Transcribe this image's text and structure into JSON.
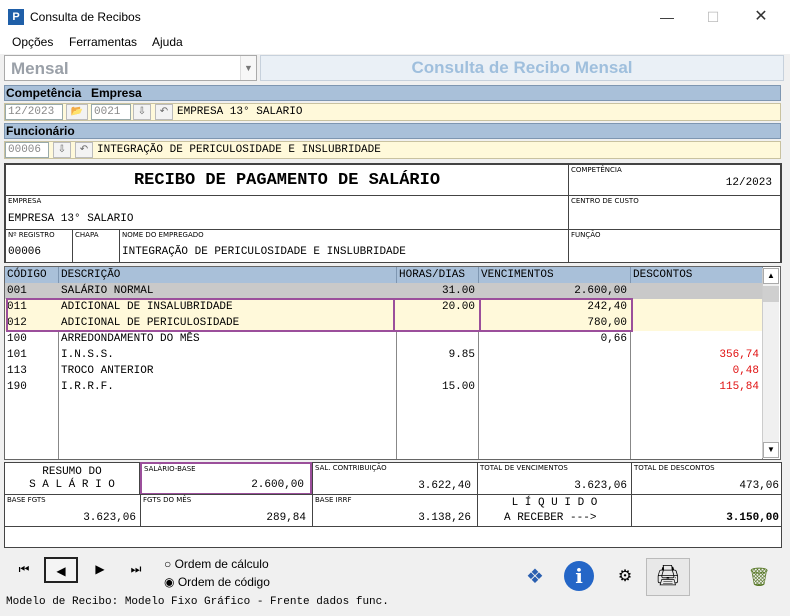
{
  "window": {
    "title": "Consulta de Recibos",
    "app_icon_letter": "P"
  },
  "menu": [
    "Opções",
    "Ferramentas",
    "Ajuda"
  ],
  "header": {
    "mode_select": "Mensal",
    "banner": "Consulta de Recibo Mensal"
  },
  "labels": {
    "competencia": "Competência",
    "empresa": "Empresa",
    "funcionario": "Funcionário"
  },
  "filters": {
    "competencia": "12/2023",
    "empresa_code": "0021",
    "empresa_name": "EMPRESA 13° SALARIO",
    "funcionario_code": "00006",
    "funcionario_name": "INTEGRAÇÃO DE PERICULOSIDADE E INSLUBRIDADE"
  },
  "recibo": {
    "title": "RECIBO DE PAGAMENTO DE SALÁRIO",
    "competencia_label": "COMPETÊNCIA",
    "competencia": "12/2023",
    "empresa_label": "EMPRESA",
    "empresa": "EMPRESA 13° SALARIO",
    "centro_label": "CENTRO DE CUSTO",
    "registro_label": "Nº REGISTRO",
    "registro": "00006",
    "chapa_label": "CHAPA",
    "nome_label": "NOME DO EMPREGADO",
    "nome": "INTEGRAÇÃO DE PERICULOSIDADE E INSLUBRIDADE",
    "funcao_label": "FUNÇÃO"
  },
  "table": {
    "headers": [
      "CÓDIGO",
      "DESCRIÇÃO",
      "HORAS/DIAS",
      "VENCIMENTOS",
      "DESCONTOS"
    ],
    "rows": [
      {
        "codigo": "001",
        "descricao": "SALÁRIO NORMAL",
        "horas": "31.00",
        "vencimentos": "2.600,00",
        "descontos": ""
      },
      {
        "codigo": "011",
        "descricao": "ADICIONAL DE INSALUBRIDADE",
        "horas": "20.00",
        "vencimentos": "242,40",
        "descontos": ""
      },
      {
        "codigo": "012",
        "descricao": "ADICIONAL DE PERICULOSIDADE",
        "horas": "",
        "vencimentos": "780,00",
        "descontos": ""
      },
      {
        "codigo": "100",
        "descricao": "ARREDONDAMENTO DO MÊS",
        "horas": "",
        "vencimentos": "0,66",
        "descontos": ""
      },
      {
        "codigo": "101",
        "descricao": "I.N.S.S.",
        "horas": "9.85",
        "vencimentos": "",
        "descontos": "356,74"
      },
      {
        "codigo": "113",
        "descricao": "TROCO ANTERIOR",
        "horas": "",
        "vencimentos": "",
        "descontos": "0,48"
      },
      {
        "codigo": "190",
        "descricao": "I.R.R.F.",
        "horas": "15.00",
        "vencimentos": "",
        "descontos": "115,84"
      }
    ],
    "highlight_color": "#9b4f9b",
    "discount_color": "#e01010"
  },
  "summary": {
    "resumo_line1": "RESUMO DO",
    "resumo_line2": "S A L Á R I O",
    "salario_base_label": "SALÁRIO-BASE",
    "salario_base": "2.600,00",
    "sal_contrib_label": "SAL. CONTRIBUIÇÃO",
    "sal_contrib": "3.622,40",
    "total_venc_label": "TOTAL DE VENCIMENTOS",
    "total_venc": "3.623,06",
    "total_desc_label": "TOTAL DE DESCONTOS",
    "total_desc": "473,06",
    "base_fgts_label": "BASE FGTS",
    "base_fgts": "3.623,06",
    "fgts_mes_label": "FGTS DO MÊS",
    "fgts_mes": "289,84",
    "base_irrf_label": "BASE IRRF",
    "base_irrf": "3.138,26",
    "liquido_line1": "L Í Q U I D O",
    "liquido_line2": "A RECEBER --->",
    "liquido": "3.150,00"
  },
  "options": {
    "ordem_calculo": "Ordem de cálculo",
    "ordem_codigo": "Ordem de código",
    "selected": "ordem_codigo"
  },
  "status": "Modelo de Recibo: Modelo Fixo Gráfico - Frente dados func."
}
